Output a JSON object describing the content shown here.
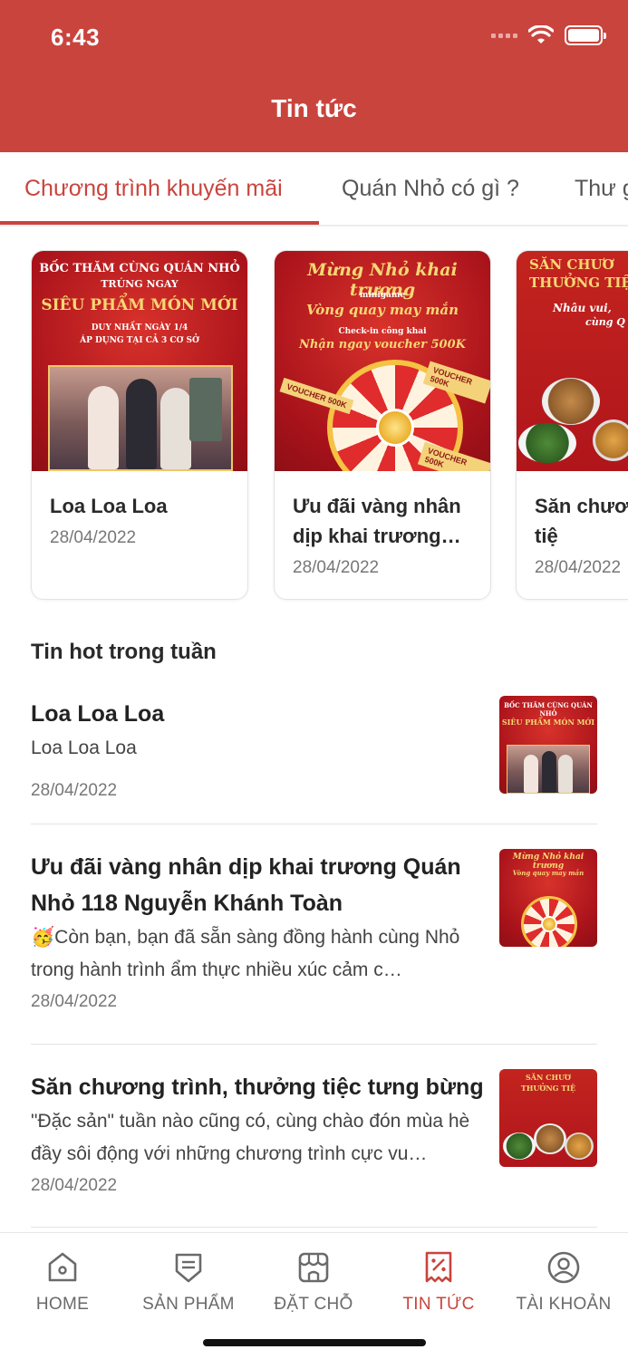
{
  "status_bar": {
    "time": "6:43"
  },
  "header": {
    "title": "Tin tức"
  },
  "tabs": [
    {
      "label": "Chương trình khuyến mãi",
      "active": true
    },
    {
      "label": "Quán Nhỏ có gì ?",
      "active": false
    },
    {
      "label": "Thư g",
      "active": false
    }
  ],
  "featured": [
    {
      "title": "Loa Loa Loa",
      "date": "28/04/2022",
      "image": {
        "line1": "BỐC THĂM CÙNG QUÁN NHỎ",
        "line2": "TRÚNG NGAY",
        "line3": "SIÊU PHẨM MÓN MỚI",
        "line4": "DUY NHẤT NGÀY 1/4",
        "line5": "ÁP DỤNG TẠI CẢ 3 CƠ SỞ"
      }
    },
    {
      "title": "Ưu đãi vàng nhân dịp khai trương…",
      "date": "28/04/2022",
      "image": {
        "line1": "Mừng Nhỏ khai trương",
        "line2": "minigame",
        "line3": "Vòng quay may mắn",
        "line4": "Check-in công khai",
        "line5": "Nhận ngay voucher 500K",
        "ribbon": "VOUCHER 500K"
      }
    },
    {
      "title": "Săn chươ thưởng tiệ",
      "date": "28/04/2022",
      "image": {
        "line1": "SĂN CHƯƠ",
        "line2": "THƯỞNG TIỆ",
        "line3": "Nhâu vui,",
        "line4": "cùng Q"
      }
    }
  ],
  "hot_section": {
    "title": "Tin hot trong tuần"
  },
  "news": [
    {
      "title": "Loa Loa Loa",
      "description": "Loa Loa Loa",
      "date": "28/04/2022"
    },
    {
      "title": "Ưu đãi vàng nhân dịp khai trương Quán Nhỏ 118 Nguyễn Khánh Toàn",
      "description": "🥳Còn bạn, bạn đã sẵn sàng đồng hành cùng Nhỏ trong hành trình ẩm thực nhiều xúc cảm c…",
      "date": "28/04/2022"
    },
    {
      "title": "Săn chương trình, thưởng tiệc tưng bừng",
      "description": "\"Đặc sản\" tuần nào cũng có, cùng chào đón mùa hè đầy sôi động với những chương trình cực vu…",
      "date": "28/04/2022"
    }
  ],
  "bottom_nav": [
    {
      "label": "HOME",
      "icon": "home-icon",
      "active": false
    },
    {
      "label": "SẢN PHẨM",
      "icon": "product-icon",
      "active": false
    },
    {
      "label": "ĐẶT CHỖ",
      "icon": "store-icon",
      "active": false
    },
    {
      "label": "TIN TỨC",
      "icon": "news-icon",
      "active": true
    },
    {
      "label": "TÀI KHOẢN",
      "icon": "account-icon",
      "active": false
    }
  ],
  "colors": {
    "brand": "#c9443d",
    "muted": "#6a6a6a"
  }
}
